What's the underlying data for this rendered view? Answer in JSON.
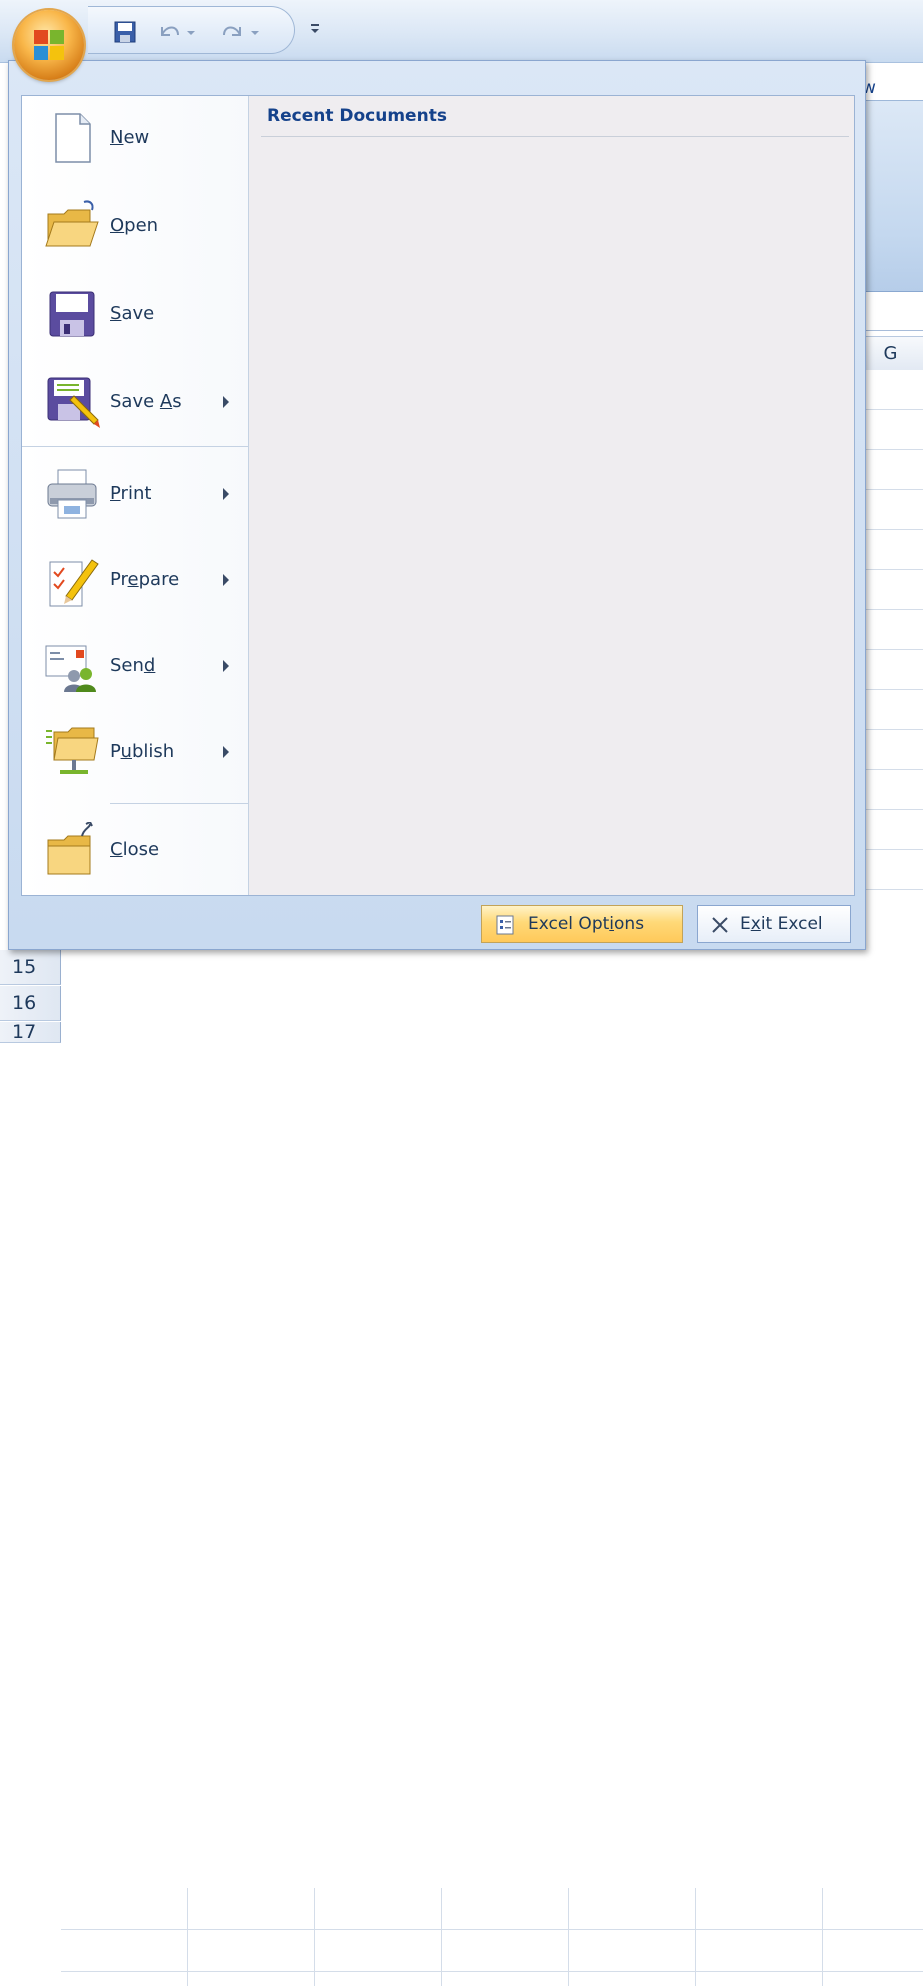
{
  "office_menu": {
    "items": [
      {
        "label": "New",
        "underline": "N",
        "icon": "new-document-icon",
        "has_submenu": false
      },
      {
        "label": "Open",
        "underline": "O",
        "icon": "open-folder-icon",
        "has_submenu": false
      },
      {
        "label": "Save",
        "underline": "S",
        "icon": "save-disk-icon",
        "has_submenu": false
      },
      {
        "label": "Save As",
        "underline": "A",
        "icon": "save-as-icon",
        "has_submenu": true
      },
      {
        "label": "Print",
        "underline": "P",
        "icon": "printer-icon",
        "has_submenu": true
      },
      {
        "label": "Prepare",
        "underline": "e",
        "icon": "prepare-icon",
        "has_submenu": true
      },
      {
        "label": "Send",
        "underline": "d",
        "icon": "send-icon",
        "has_submenu": true
      },
      {
        "label": "Publish",
        "underline": "u",
        "icon": "publish-icon",
        "has_submenu": true
      },
      {
        "label": "Close",
        "underline": "C",
        "icon": "close-folder-icon",
        "has_submenu": false
      }
    ],
    "recent_documents_title": "Recent Documents",
    "footer": {
      "options_label": "Excel Options",
      "exit_label": "Exit Excel"
    }
  },
  "background": {
    "ribbon_tab_fragment": "w",
    "column_header": "G",
    "row_headers": [
      "15",
      "16",
      "17"
    ]
  },
  "colors": {
    "accent": "#15428b",
    "menu_frame": "#c8daf0",
    "recent_pane": "#efedf0",
    "options_highlight": "#ffd978"
  }
}
